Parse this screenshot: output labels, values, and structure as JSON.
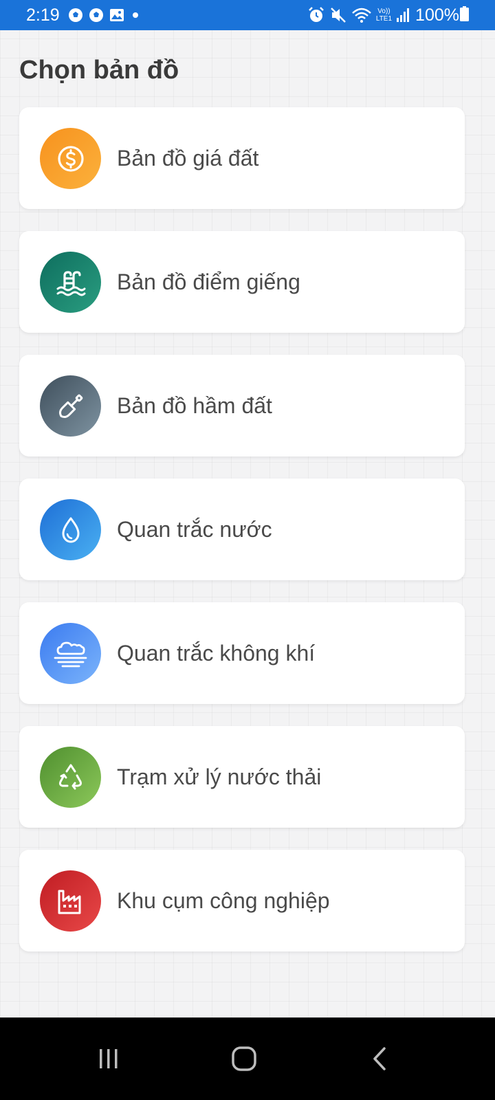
{
  "status_bar": {
    "time": "2:19",
    "battery_percent": "100%",
    "left_icons": [
      "soccer-ball-icon",
      "soccer-ball-icon",
      "image-icon",
      "dot-icon"
    ],
    "right_icons": [
      "alarm-icon",
      "mute-icon",
      "wifi-icon",
      "volte-icon",
      "signal-icon",
      "battery-icon"
    ],
    "background_color": "#1a73d9",
    "volte_label": "Vo))",
    "lte_label": "LTE1"
  },
  "page": {
    "title": "Chọn bản đồ"
  },
  "menu": {
    "items": [
      {
        "label": "Bản đồ giá đất",
        "icon": "dollar-coin-icon",
        "color": "#f7921e"
      },
      {
        "label": "Bản đồ điểm giếng",
        "icon": "pool-ladder-icon",
        "color": "#0e6e5e"
      },
      {
        "label": "Bản đồ hầm đất",
        "icon": "shovel-icon",
        "color": "#4f5f6c"
      },
      {
        "label": "Quan trắc nước",
        "icon": "water-drop-icon",
        "color": "#1e6fd6"
      },
      {
        "label": "Quan trắc không khí",
        "icon": "cloud-wind-icon",
        "color": "#3b7bf0"
      },
      {
        "label": "Trạm xử lý nước thải",
        "icon": "recycle-icon",
        "color": "#5e9c3a"
      },
      {
        "label": "Khu cụm công nghiệp",
        "icon": "factory-icon",
        "color": "#c01d23"
      }
    ]
  },
  "nav_bar": {
    "buttons": [
      "recent-apps-icon",
      "home-icon",
      "back-icon"
    ]
  }
}
